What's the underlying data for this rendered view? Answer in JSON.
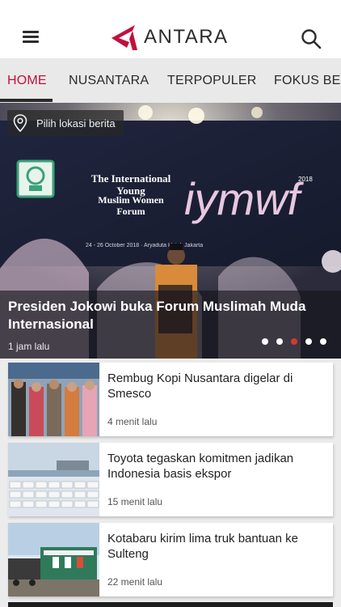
{
  "header": {
    "logo_text": "ANTARA",
    "logo_color": "#c0103e",
    "menu_icon": "hamburger-menu-icon",
    "search_icon": "search-icon"
  },
  "tabs": [
    {
      "label": "HOME",
      "active": true
    },
    {
      "label": "NUSANTARA",
      "active": false
    },
    {
      "label": "TERPOPULER",
      "active": false
    },
    {
      "label": "FOKUS BERITA",
      "active": false
    }
  ],
  "hero": {
    "location_chip": "Pilih lokasi berita",
    "title": "Presiden Jokowi buka Forum Muslimah Muda Internasional",
    "time": "1 jam lalu",
    "slide_count": 5,
    "active_slide": 3,
    "banner_event": "The International Young Muslim Women Forum",
    "banner_logo": "iymwf",
    "banner_year": "2018"
  },
  "articles": [
    {
      "title": "Rembug Kopi Nusantara digelar di Smesco",
      "time": "4 menit lalu"
    },
    {
      "title": "Toyota tegaskan komitmen jadikan Indonesia basis ekspor",
      "time": "15 menit lalu"
    },
    {
      "title": "Kotabaru kirim lima truk bantuan ke Sulteng",
      "time": "22 menit lalu"
    }
  ],
  "colors": {
    "accent": "#c0103e",
    "active_dot": "#d4392f",
    "tab_bar": "#e9e9e9"
  }
}
